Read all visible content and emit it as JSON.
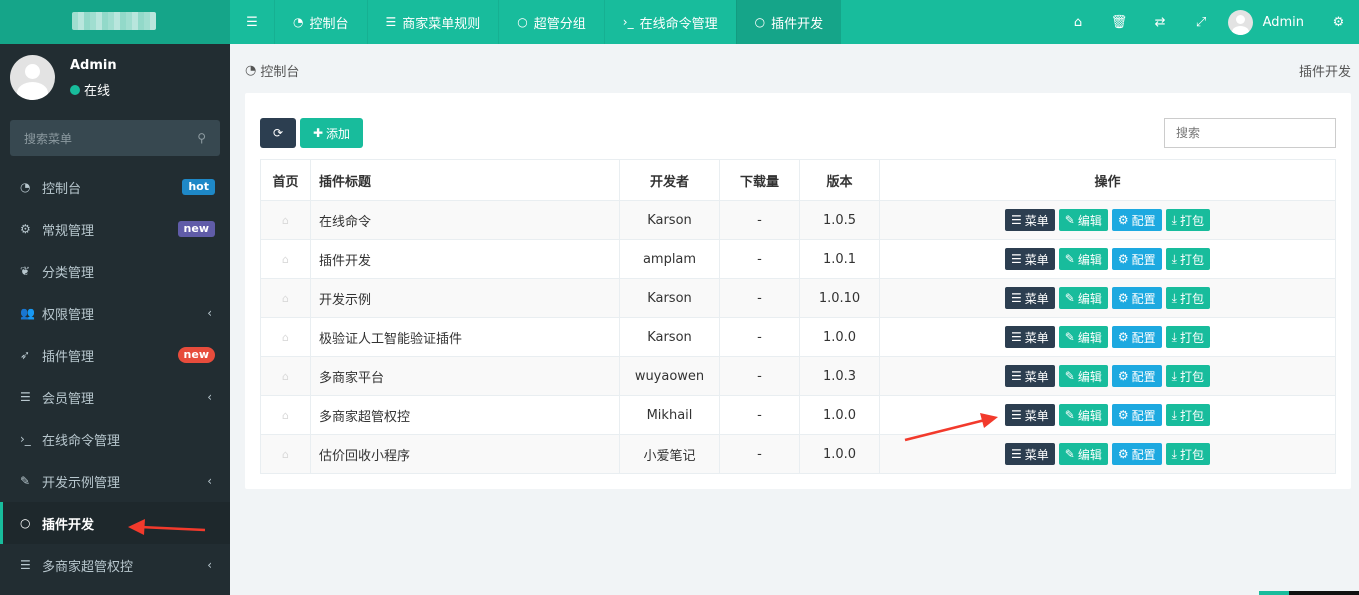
{
  "topbar": {
    "tabs": [
      {
        "icon": "dashboard-icon",
        "label": "控制台"
      },
      {
        "icon": "list-icon",
        "label": "商家菜单规则"
      },
      {
        "icon": "circle-icon",
        "label": "超管分组"
      },
      {
        "icon": "terminal-icon",
        "label": "在线命令管理"
      },
      {
        "icon": "circle-icon",
        "label": "插件开发"
      }
    ],
    "active_tab": 4,
    "user_name": "Admin"
  },
  "sidebar": {
    "user_name": "Admin",
    "user_status": "在线",
    "search_placeholder": "搜索菜单",
    "items": [
      {
        "label": "控制台",
        "icon": "dashboard-icon",
        "badge": "hot",
        "badge_color": "#1e88c7"
      },
      {
        "label": "常规管理",
        "icon": "cogs-icon",
        "badge": "new",
        "badge_color": "#605ca8"
      },
      {
        "label": "分类管理",
        "icon": "leaf-icon"
      },
      {
        "label": "权限管理",
        "icon": "users-icon",
        "chevron": true
      },
      {
        "label": "插件管理",
        "icon": "rocket-icon",
        "badge": "new",
        "badge_color": "#e74c3c",
        "badge_round": true
      },
      {
        "label": "会员管理",
        "icon": "list-icon",
        "chevron": true
      },
      {
        "label": "在线命令管理",
        "icon": "terminal-icon"
      },
      {
        "label": "开发示例管理",
        "icon": "magic-icon",
        "chevron": true
      },
      {
        "label": "插件开发",
        "icon": "circle-icon",
        "active": true
      },
      {
        "label": "多商家超管权控",
        "icon": "list-icon",
        "chevron": true
      }
    ]
  },
  "breadcrumb": {
    "left": "控制台",
    "right": "插件开发"
  },
  "toolbar": {
    "add_label": "添加",
    "search_placeholder": "搜索"
  },
  "table": {
    "headers": [
      "首页",
      "插件标题",
      "开发者",
      "下载量",
      "版本",
      "操作"
    ],
    "rows": [
      {
        "title": "在线命令",
        "author": "Karson",
        "downloads": "-",
        "version": "1.0.5"
      },
      {
        "title": "插件开发",
        "author": "amplam",
        "downloads": "-",
        "version": "1.0.1"
      },
      {
        "title": "开发示例",
        "author": "Karson",
        "downloads": "-",
        "version": "1.0.10"
      },
      {
        "title": "极验证人工智能验证插件",
        "author": "Karson",
        "downloads": "-",
        "version": "1.0.0"
      },
      {
        "title": "多商家平台",
        "author": "wuyaowen",
        "downloads": "-",
        "version": "1.0.3"
      },
      {
        "title": "多商家超管权控",
        "author": "Mikhail",
        "downloads": "-",
        "version": "1.0.0"
      },
      {
        "title": "估价回收小程序",
        "author": "小爱笔记",
        "downloads": "-",
        "version": "1.0.0"
      }
    ],
    "actions": {
      "menu": "菜单",
      "edit": "编辑",
      "config": "配置",
      "pack": "打包"
    }
  },
  "colors": {
    "accent": "#18bc9c",
    "dark": "#2c3e50",
    "info": "#1da9e0",
    "sidebar": "#222d32",
    "annotation_arrow": "#f23a2c"
  }
}
